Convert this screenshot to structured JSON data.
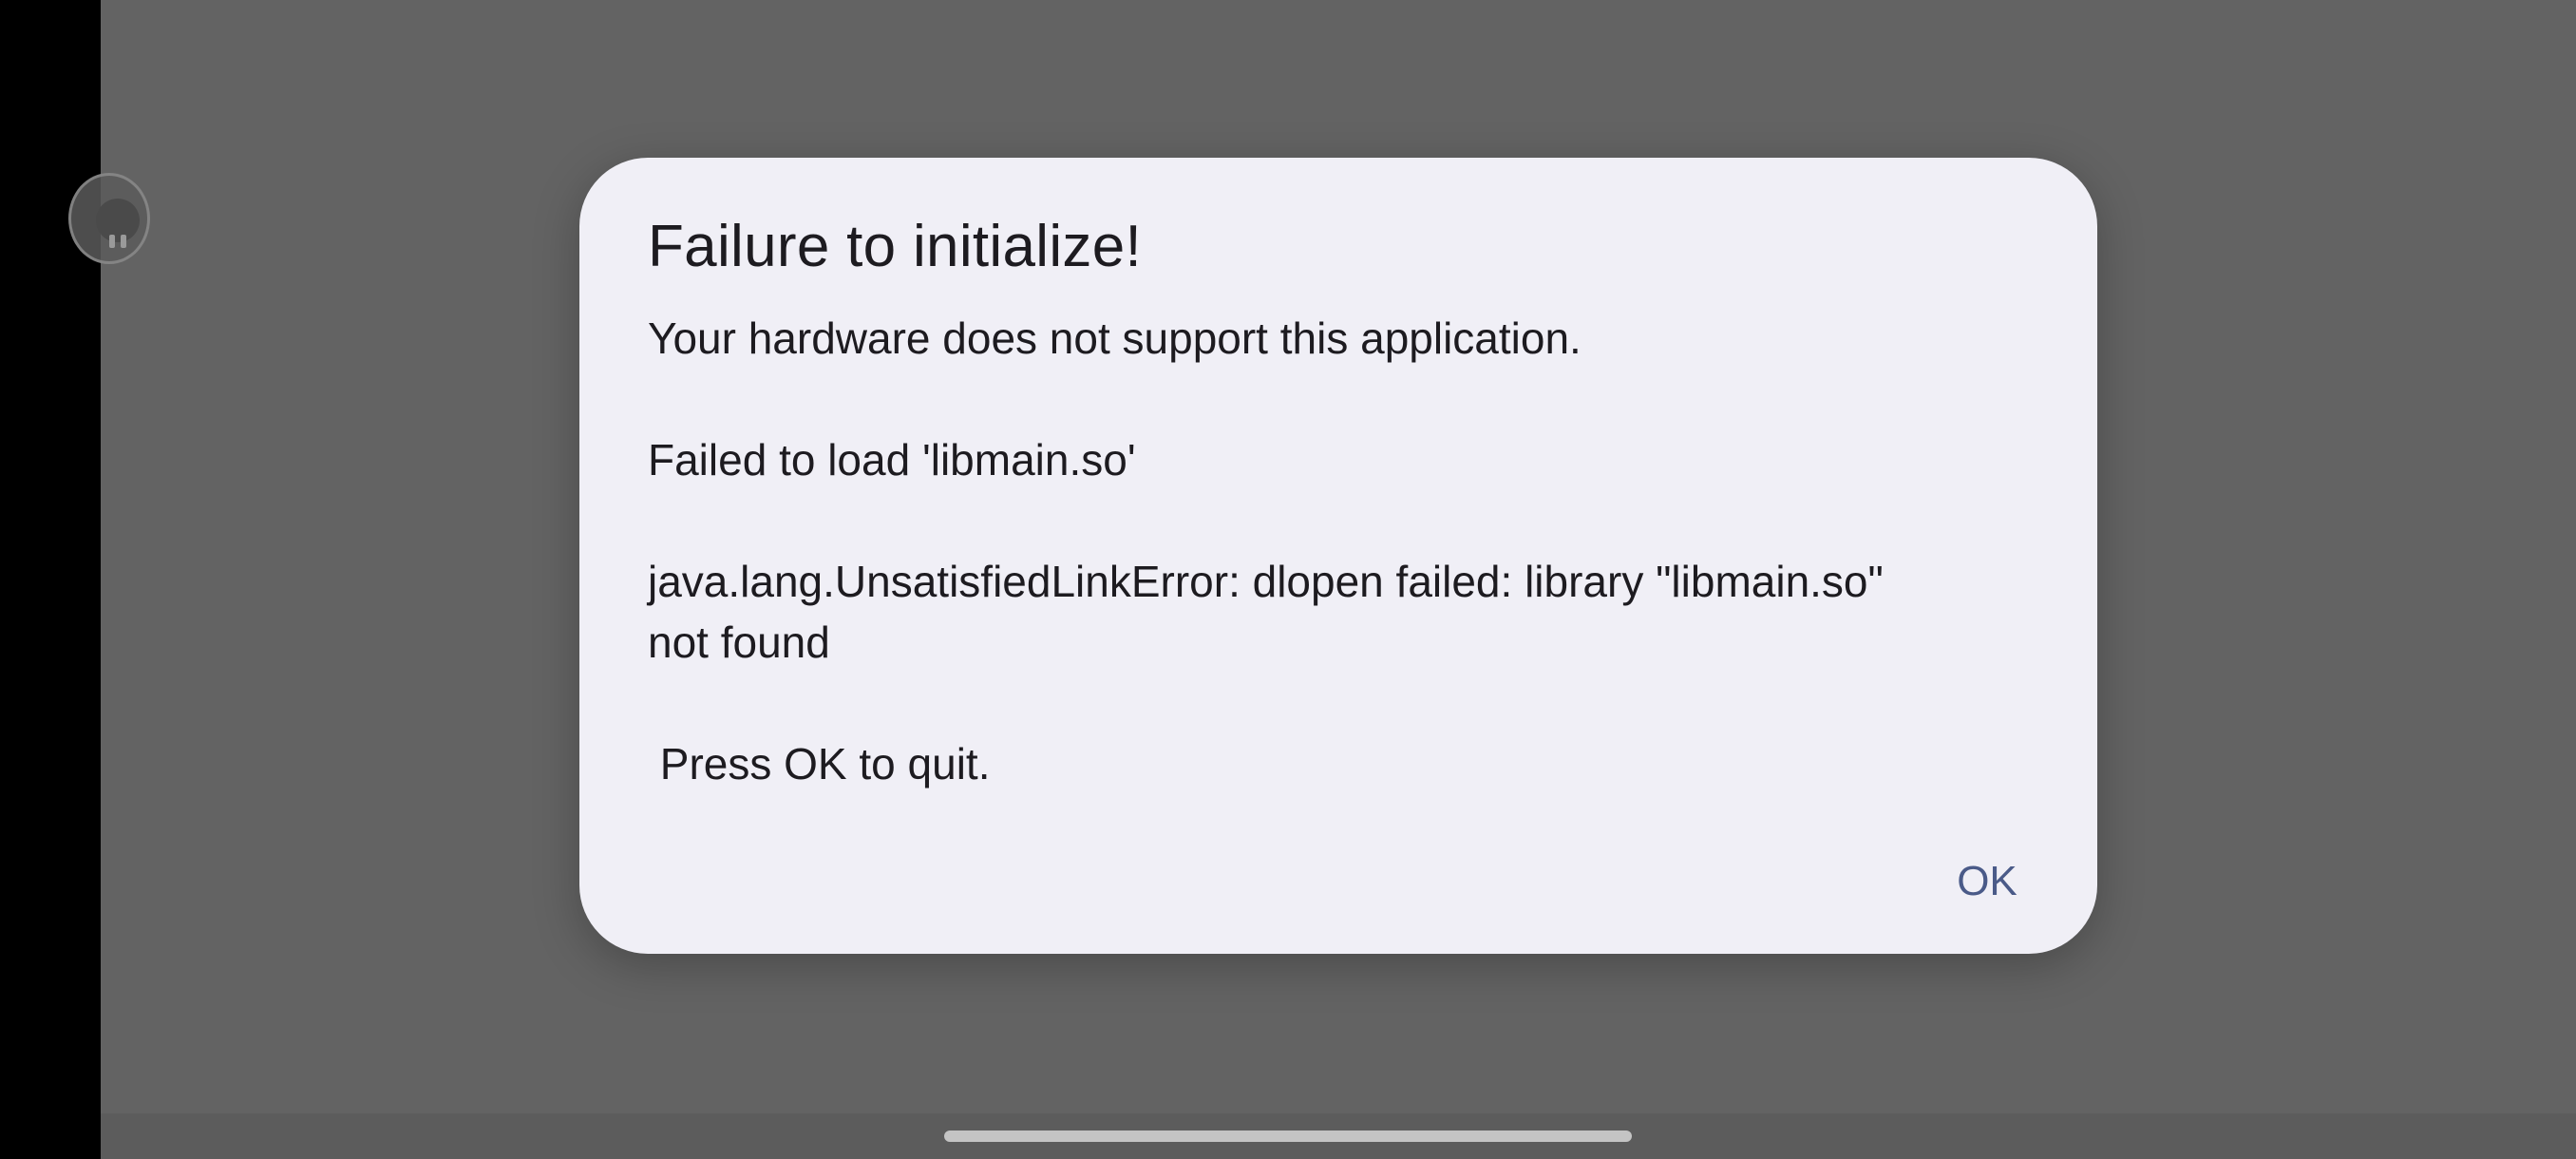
{
  "dialog": {
    "title": "Failure to initialize!",
    "message_lines": [
      "Your hardware does not support this application.",
      "",
      "Failed to load 'libmain.so'",
      "",
      "java.lang.UnsatisfiedLinkError: dlopen failed: library \"libmain.so\"",
      "not found",
      "",
      " Press OK to quit."
    ],
    "ok_label": "OK"
  },
  "floating_bubble": {
    "icon": "floating-bubble-icon"
  },
  "colors": {
    "scrim": "#636363",
    "dialog_background": "#f0eff6",
    "text": "#1d1b20",
    "accent": "#4a5a88"
  }
}
